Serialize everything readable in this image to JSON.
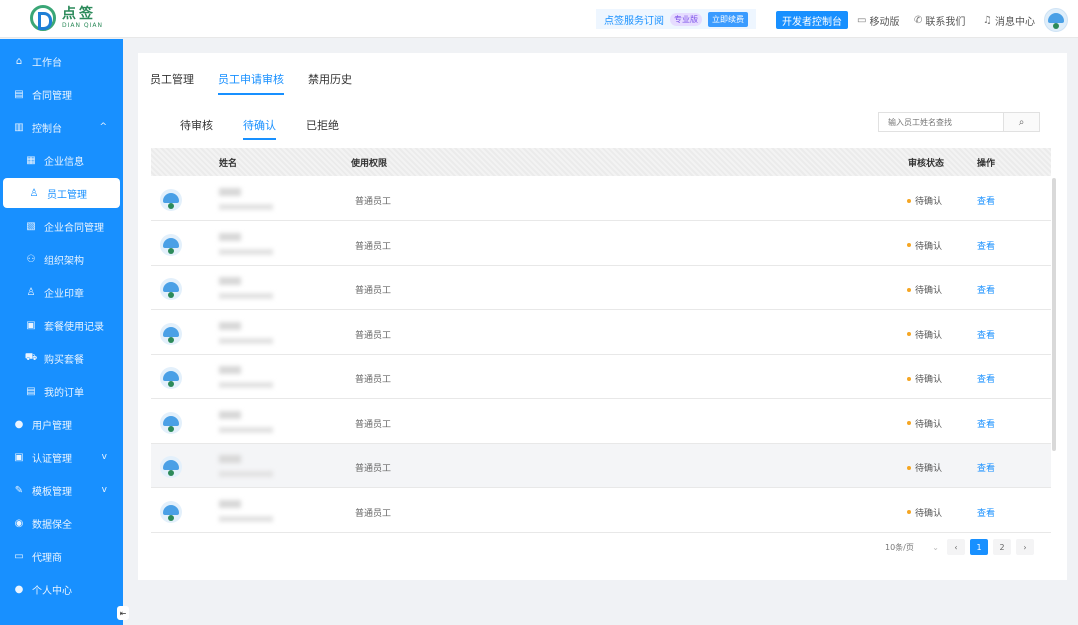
{
  "brand": {
    "name_cn": "点签",
    "name_en": "DIAN QIAN"
  },
  "topbar": {
    "service_label": "点签服务订阅",
    "vip_label": "专业版",
    "renew_label": "立即续费",
    "dev_console_label": "开发者控制台",
    "links": [
      {
        "icon": "clipboard-icon",
        "label": "移动版"
      },
      {
        "icon": "phone-icon",
        "label": "联系我们"
      },
      {
        "icon": "bell-icon",
        "label": "消息中心"
      }
    ]
  },
  "sidebar": {
    "items": [
      {
        "icon": "home-icon",
        "glyph": "⌂",
        "label": "工作台",
        "level": 1
      },
      {
        "icon": "contract-icon",
        "glyph": "▤",
        "label": "合同管理",
        "level": 1
      },
      {
        "icon": "chart-icon",
        "glyph": "▥",
        "label": "控制台",
        "level": 1,
        "chevron": "^"
      },
      {
        "icon": "building-icon",
        "glyph": "▦",
        "label": "企业信息",
        "level": 2
      },
      {
        "icon": "user-icon",
        "glyph": "♙",
        "label": "员工管理",
        "level": 2,
        "active": true
      },
      {
        "icon": "doc-icon",
        "glyph": "▧",
        "label": "企业合同管理",
        "level": 2
      },
      {
        "icon": "org-icon",
        "glyph": "⚇",
        "label": "组织架构",
        "level": 2
      },
      {
        "icon": "seal-icon",
        "glyph": "♙",
        "label": "企业印章",
        "level": 2
      },
      {
        "icon": "record-icon",
        "glyph": "▣",
        "label": "套餐使用记录",
        "level": 2
      },
      {
        "icon": "cart-icon",
        "glyph": "⛟",
        "label": "购买套餐",
        "level": 2
      },
      {
        "icon": "order-icon",
        "glyph": "▤",
        "label": "我的订单",
        "level": 2
      },
      {
        "icon": "person-icon",
        "glyph": "●",
        "label": "用户管理",
        "level": 1
      },
      {
        "icon": "auth-icon",
        "glyph": "▣",
        "label": "认证管理",
        "level": 1,
        "chevron": "v"
      },
      {
        "icon": "template-icon",
        "glyph": "✎",
        "label": "模板管理",
        "level": 1,
        "chevron": "v"
      },
      {
        "icon": "lock-icon",
        "glyph": "◉",
        "label": "数据保全",
        "level": 1
      },
      {
        "icon": "briefcase-icon",
        "glyph": "▭",
        "label": "代理商",
        "level": 1
      },
      {
        "icon": "profile-icon",
        "glyph": "●",
        "label": "个人中心",
        "level": 1
      }
    ]
  },
  "main": {
    "tabs": [
      "员工管理",
      "员工申请审核",
      "禁用历史"
    ],
    "active_tab": 1,
    "subtabs": [
      "待审核",
      "待确认",
      "已拒绝"
    ],
    "active_subtab": 1,
    "search": {
      "placeholder": "输入员工姓名查找"
    },
    "columns": {
      "name": "姓名",
      "permission": "使用权限",
      "status": "审核状态",
      "action": "操作"
    },
    "rows": [
      {
        "permission": "普通员工",
        "status": "待确认",
        "action": "查看"
      },
      {
        "permission": "普通员工",
        "status": "待确认",
        "action": "查看"
      },
      {
        "permission": "普通员工",
        "status": "待确认",
        "action": "查看"
      },
      {
        "permission": "普通员工",
        "status": "待确认",
        "action": "查看"
      },
      {
        "permission": "普通员工",
        "status": "待确认",
        "action": "查看"
      },
      {
        "permission": "普通员工",
        "status": "待确认",
        "action": "查看"
      },
      {
        "permission": "普通员工",
        "status": "待确认",
        "action": "查看"
      },
      {
        "permission": "普通员工",
        "status": "待确认",
        "action": "查看"
      }
    ],
    "highlighted_row": 6,
    "pagination": {
      "page_size": "10条/页",
      "pages": [
        "1",
        "2"
      ],
      "current": 0,
      "prev": "‹",
      "next": "›"
    }
  },
  "colors": {
    "primary": "#1890ff",
    "pending_dot": "#f5a623",
    "brand_green": "#2c8a5a"
  }
}
